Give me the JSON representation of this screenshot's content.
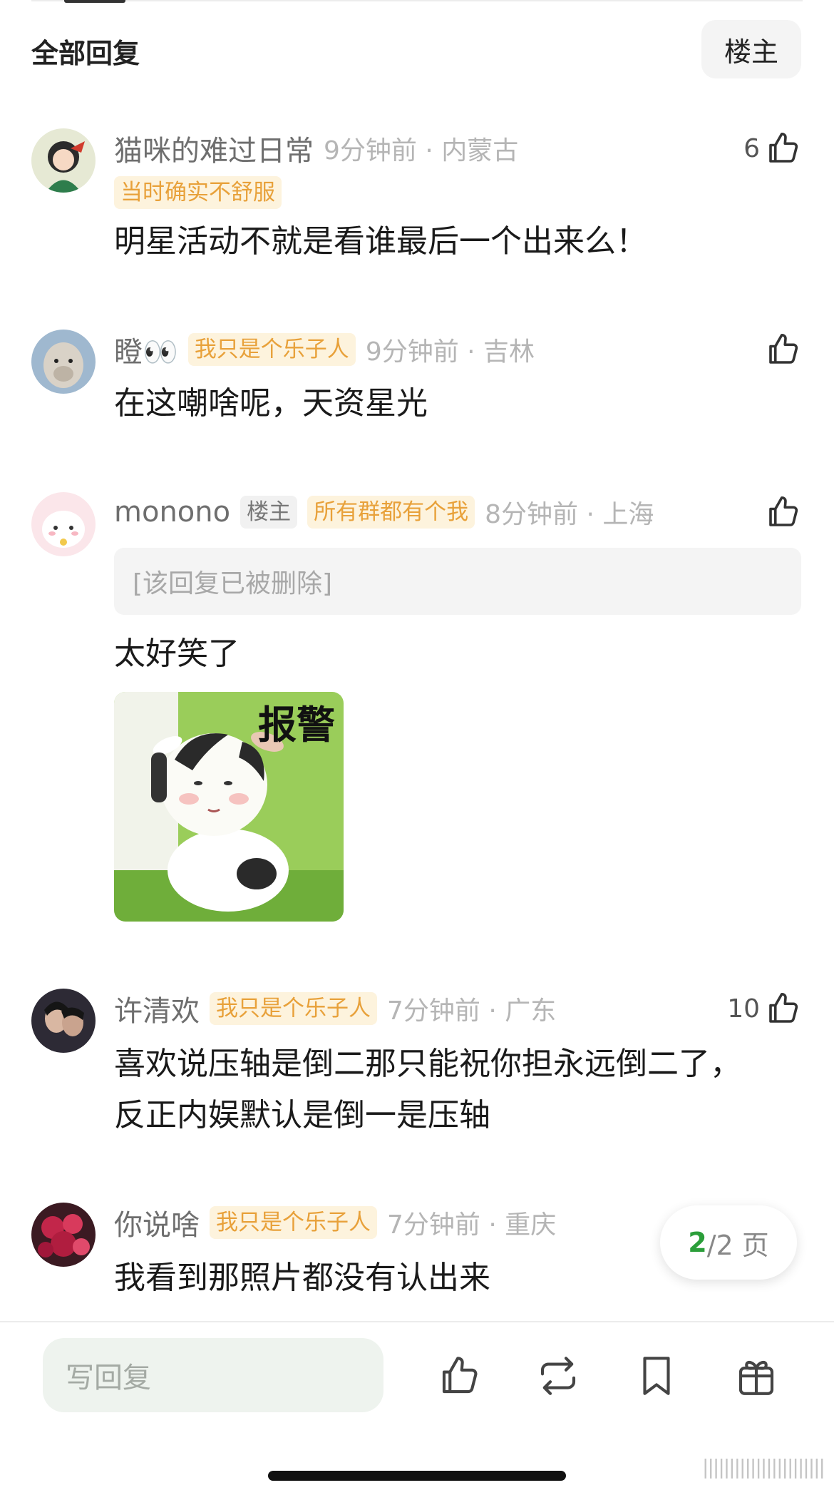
{
  "header": {
    "title": "全部回复",
    "owner_filter": "楼主"
  },
  "comments": [
    {
      "username": "猫咪的难过日常",
      "time_location": "9分钟前 · 内蒙古",
      "tag": "当时确实不舒服",
      "likes": "6",
      "text": "明星活动不就是看谁最后一个出来么！"
    },
    {
      "username": "瞪👀",
      "badge": "我只是个乐子人",
      "time_location": "9分钟前 · 吉林",
      "likes": "",
      "text": "在这嘲啥呢，天资星光"
    },
    {
      "username": "monono",
      "owner_badge": "楼主",
      "badge": "所有群都有个我",
      "time_location": "8分钟前 · 上海",
      "likes": "",
      "quoted": "[该回复已被删除]",
      "text": "太好笑了",
      "sticker_text": "报警"
    },
    {
      "username": "许清欢",
      "badge": "我只是个乐子人",
      "time_location": "7分钟前 · 广东",
      "likes": "10",
      "text": "喜欢说压轴是倒二那只能祝你担永远倒二了，反正内娱默认是倒一是压轴"
    },
    {
      "username": "你说啥",
      "badge": "我只是个乐子人",
      "time_location": "7分钟前 · 重庆",
      "likes": "",
      "text": "我看到那照片都没有认出来"
    }
  ],
  "pagination": {
    "current": "2",
    "total_label": "/2 页"
  },
  "bottom_bar": {
    "reply_placeholder": "写回复",
    "icons": [
      "like-icon",
      "repost-icon",
      "bookmark-icon",
      "gift-icon"
    ]
  },
  "colors": {
    "badge_yellow_bg": "#fdf3dd",
    "badge_yellow_text": "#e8a13a",
    "page_current": "#2b9e3a"
  }
}
